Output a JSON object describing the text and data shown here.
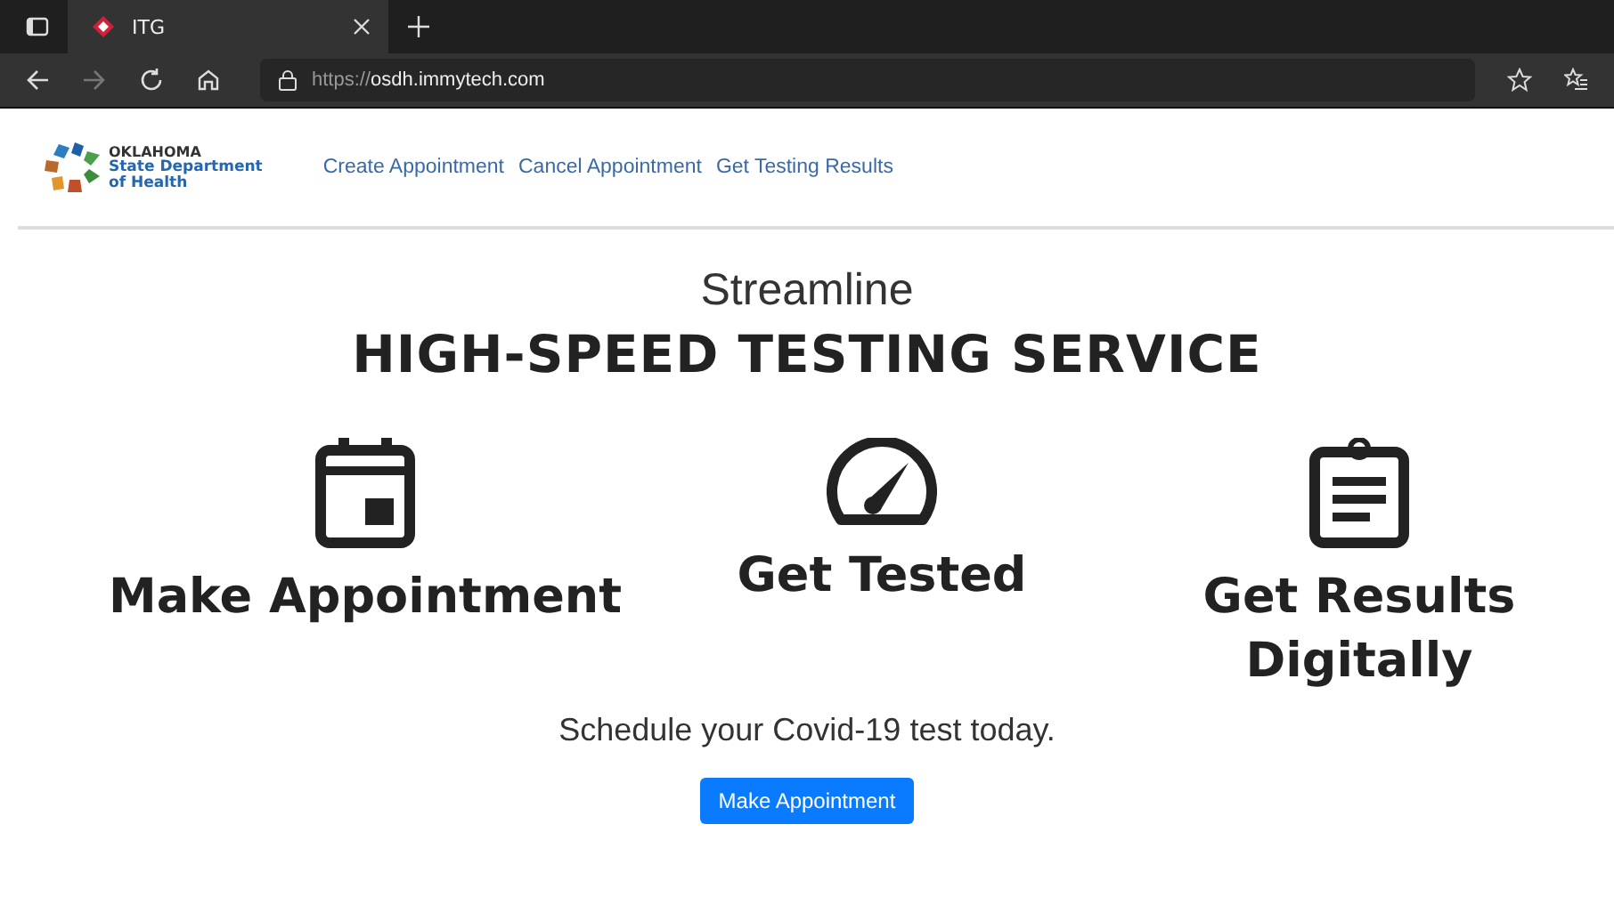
{
  "browser": {
    "tab": {
      "title": "ITG",
      "selected": true
    },
    "url_prefix": "https://",
    "url_host": "osdh.immytech.com"
  },
  "logo": {
    "lines": [
      "OKLAHOMA",
      "State Department",
      "of Health"
    ]
  },
  "nav": [
    {
      "label": "Create Appointment"
    },
    {
      "label": "Cancel Appointment"
    },
    {
      "label": "Get Testing Results"
    }
  ],
  "hero": {
    "subtitle": "Streamline",
    "title": "HIGH-SPEED TESTING SERVICE"
  },
  "features": [
    {
      "kind": "calendar",
      "label": "Make Appointment"
    },
    {
      "kind": "gauge",
      "label": "Get Tested"
    },
    {
      "kind": "clipboard",
      "label": "Get Results Digitally"
    }
  ],
  "cta": {
    "text": "Schedule your Covid-19 test today.",
    "button": "Make Appointment"
  }
}
